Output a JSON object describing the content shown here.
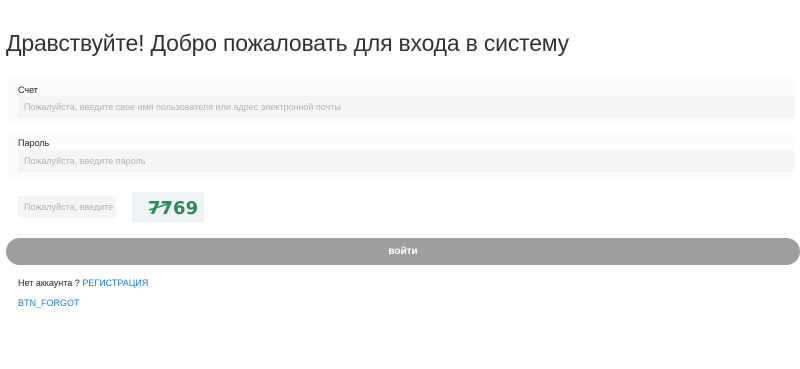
{
  "header": {
    "title": "Дравствуйте!  Добро пожаловать для входа в систему"
  },
  "form": {
    "account": {
      "label": "Счет",
      "placeholder": "Пожалуйста, введите свое имя пользователя или адрес электронной почты",
      "value": ""
    },
    "password": {
      "label": "Пароль",
      "placeholder": "Пожалуйста, введите пароль",
      "value": ""
    },
    "captcha": {
      "placeholder": "Пожалуйста, введите проверочный код",
      "value": "",
      "image_text": "7769",
      "image_color": "#2e8b57"
    },
    "login_button": "войти"
  },
  "footer": {
    "no_account_text": "Нет аккаунта ? ",
    "register_link": "РЕГИСТРАЦИЯ",
    "forgot_link": "BTN_FORGOT"
  },
  "colors": {
    "link": "#1a7fd0",
    "button_bg": "#9e9e9e",
    "input_bg": "#f5f5f5"
  }
}
